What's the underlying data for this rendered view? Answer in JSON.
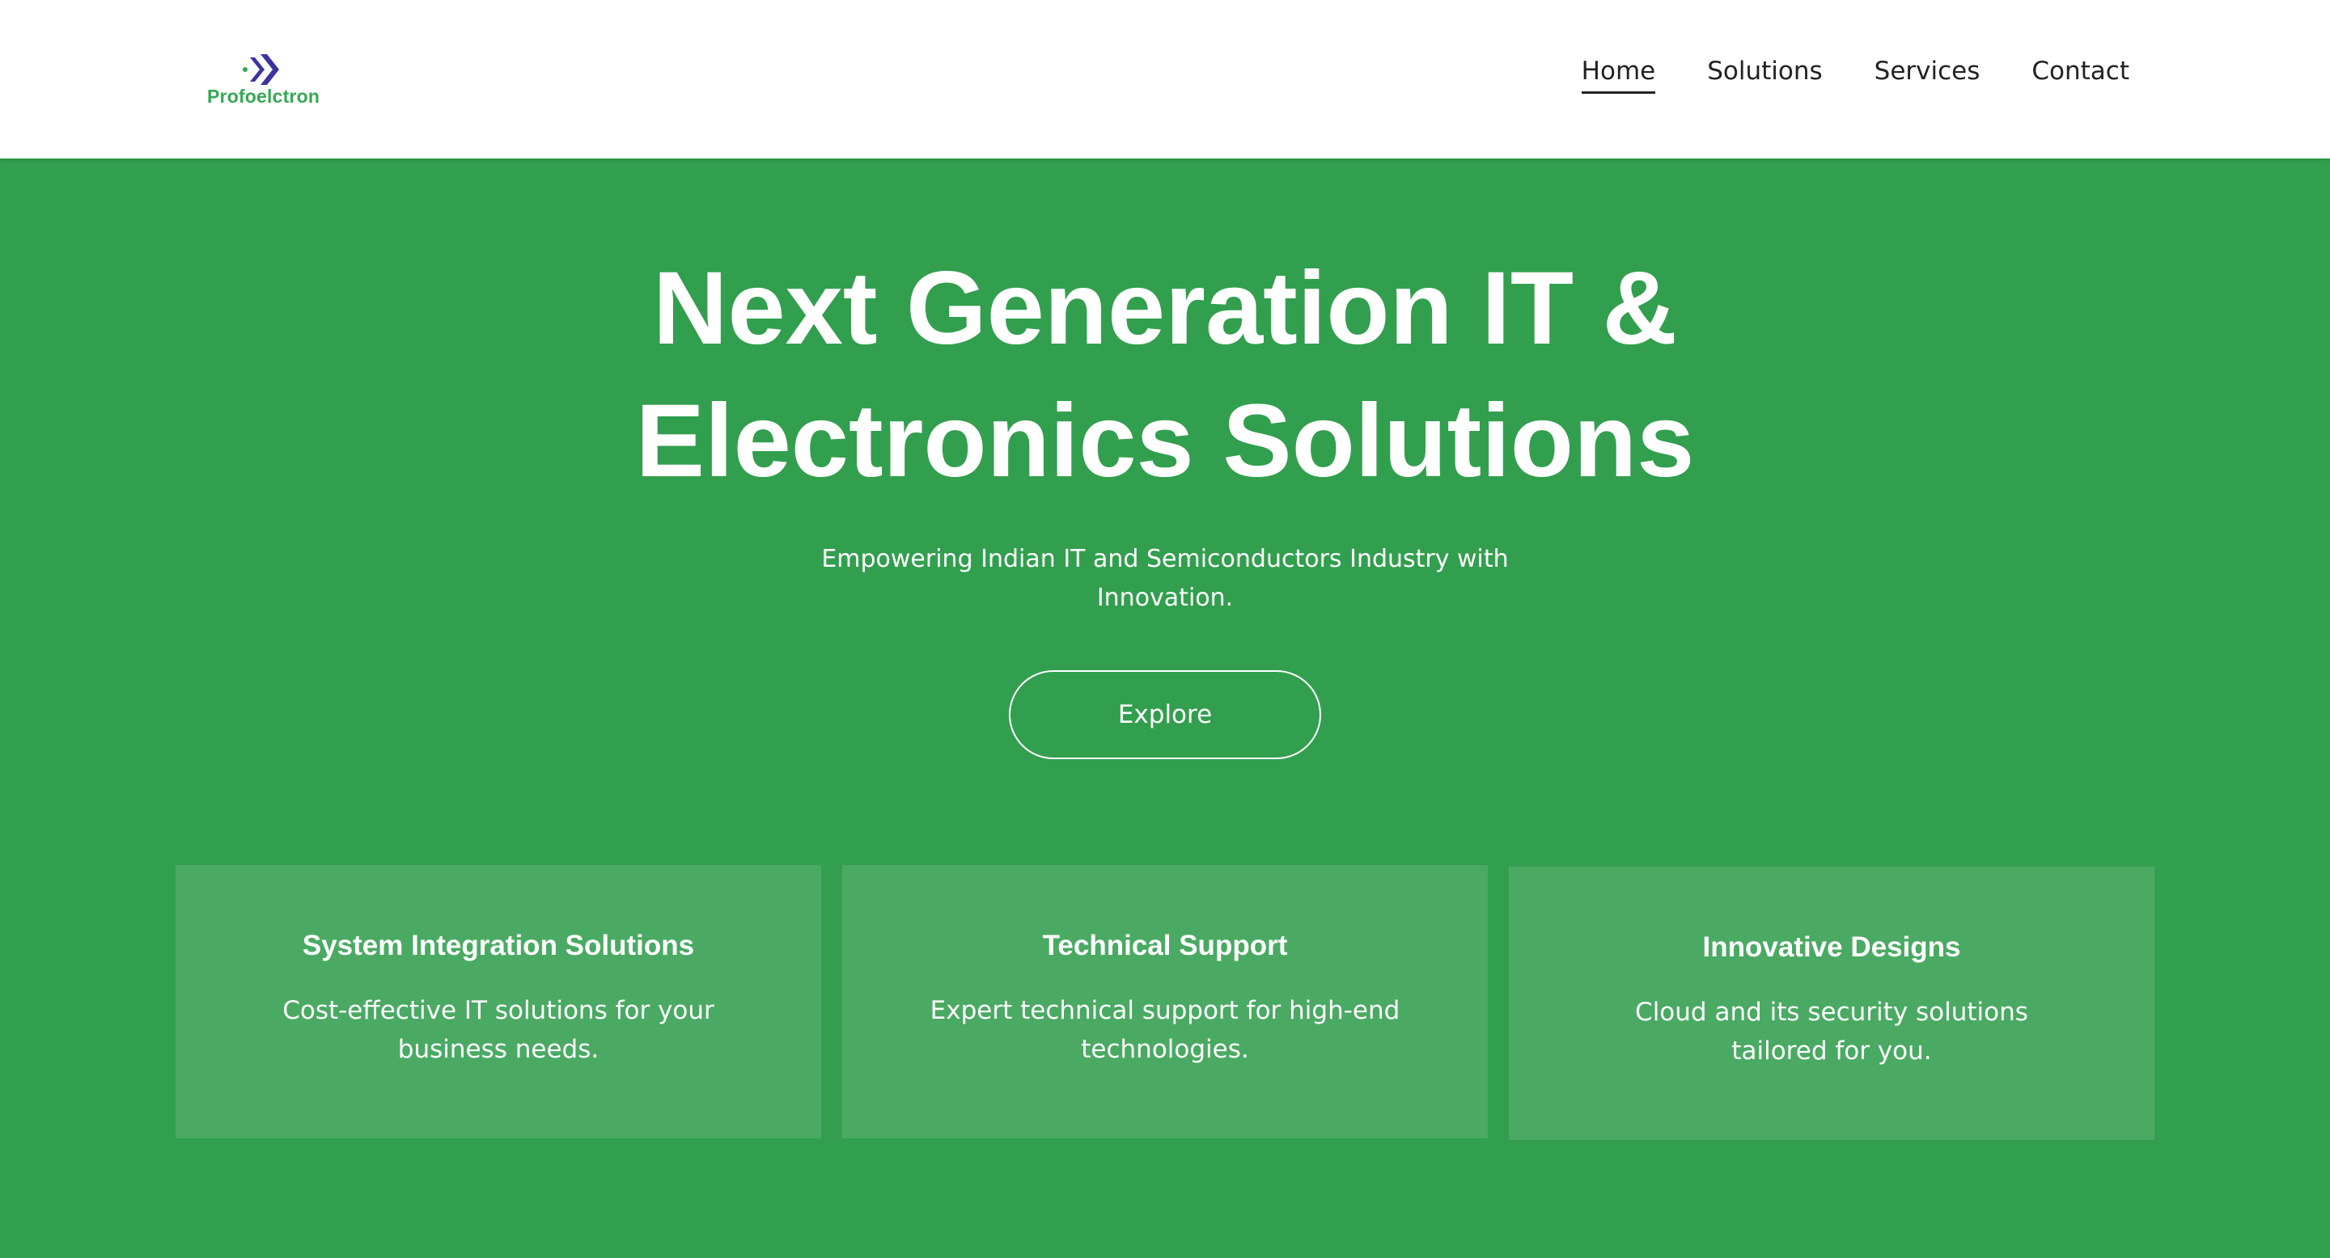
{
  "header": {
    "logo_text": "Profoelctron",
    "nav": [
      {
        "label": "Home",
        "active": true
      },
      {
        "label": "Solutions",
        "active": false
      },
      {
        "label": "Services",
        "active": false
      },
      {
        "label": "Contact",
        "active": false
      }
    ]
  },
  "hero": {
    "title_line1": "Next Generation IT &",
    "title_line2": "Electronics Solutions",
    "subtitle": "Empowering Indian IT and  Semiconductors Industry with Innovation.",
    "cta_label": "Explore"
  },
  "features": [
    {
      "title": "System Integration Solutions",
      "description": "Cost-effective IT solutions for your business needs."
    },
    {
      "title": "Technical Support",
      "description": "Expert technical support for high-end technologies."
    },
    {
      "title": "Innovative Designs",
      "description": "Cloud and its security solutions tailored for you."
    }
  ],
  "colors": {
    "brand_green": "#329f4e",
    "logo_green": "#34a853",
    "logo_mark_blue": "#3b35a0",
    "header_bg": "#ffffff"
  },
  "icons": {
    "logo_mark": "double-chevron-right-icon"
  }
}
